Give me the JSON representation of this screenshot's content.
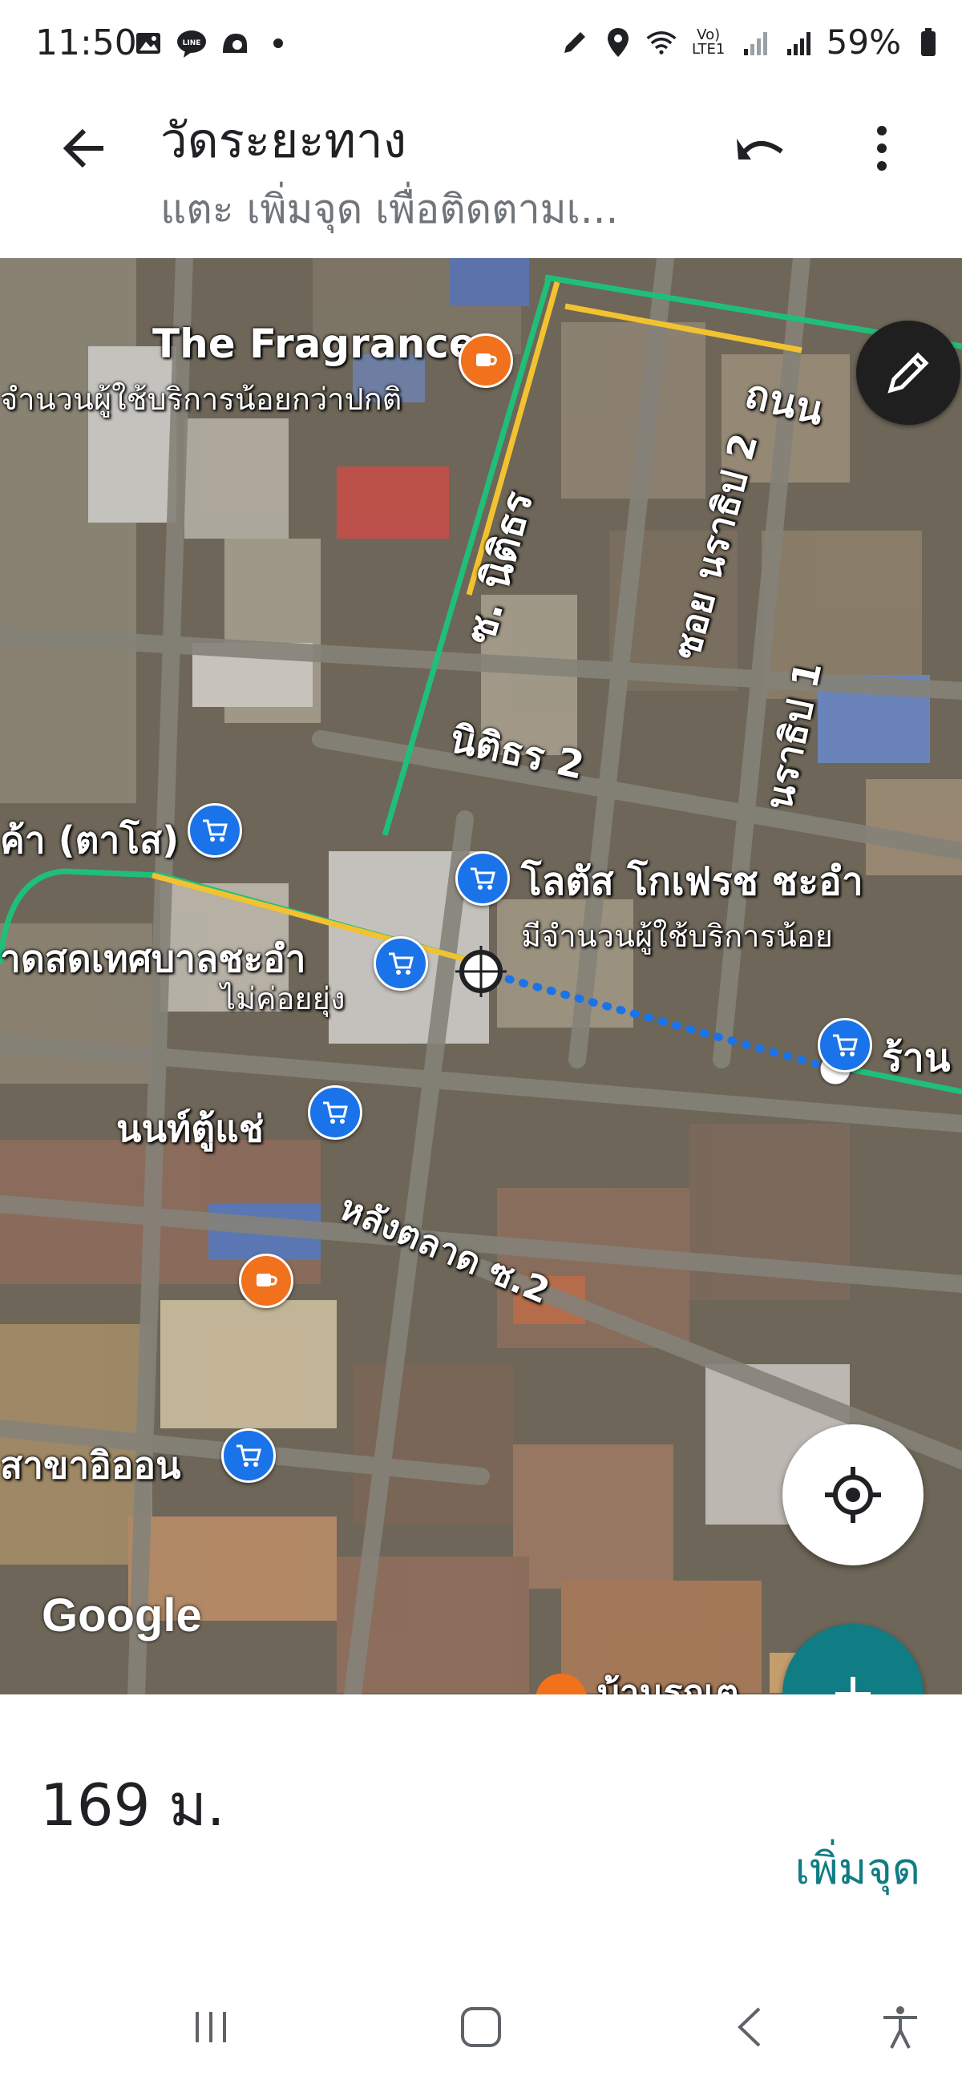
{
  "status_bar": {
    "time": "11:50",
    "network": "Vo) LTE1",
    "battery": "59%"
  },
  "header": {
    "title": "วัดระยะทาง",
    "subtitle": "แตะ เพิ่มจุด เพื่อติดตามเ...",
    "back_icon": "arrow-left-icon",
    "undo_icon": "undo-icon",
    "more_icon": "more-vertical-icon"
  },
  "map": {
    "labels": {
      "fragrance": "The Fragrance",
      "fragrance_note": "จำนวนผู้ใช้บริการน้อยกว่าปกติ",
      "thanon": "ถนน",
      "soi_nitithon": "ซ. นิติธร",
      "soi_naratip2": "ซอย นราธิป 2",
      "naratip1": "นราธิป 1",
      "nitithon2": "นิติธร 2",
      "tasso": "ค้า (ตาโส)",
      "lotus": "โลตัส โกเฟรช ชะอำ",
      "lotus_note": "มีจำนวนผู้ใช้บริการน้อย",
      "market": "าดสดเทศบาลชะอำ",
      "market_note": "ไม่ค่อยยุ่ง",
      "shop_right": "ร้าน",
      "non": "นนท์ตู้แช่",
      "langtalad": "หลังตลาด ซ.2",
      "aeon": "สาขาอิออน",
      "baan": "บ้านรถเต",
      "google": "Google"
    },
    "accent_route": "#1a73e8",
    "road_green": "#1fbf7a",
    "road_yellow": "#f2c230",
    "edit_icon": "pencil-icon",
    "locate_icon": "my-location-icon"
  },
  "sheet": {
    "distance": "169 ม.",
    "add_point_label": "เพิ่มจุด",
    "add_icon": "plus-icon"
  },
  "navbar": {
    "recent_icon": "recent-apps-icon",
    "home_icon": "home-icon",
    "back_icon": "nav-back-icon",
    "a11y_icon": "accessibility-icon"
  }
}
